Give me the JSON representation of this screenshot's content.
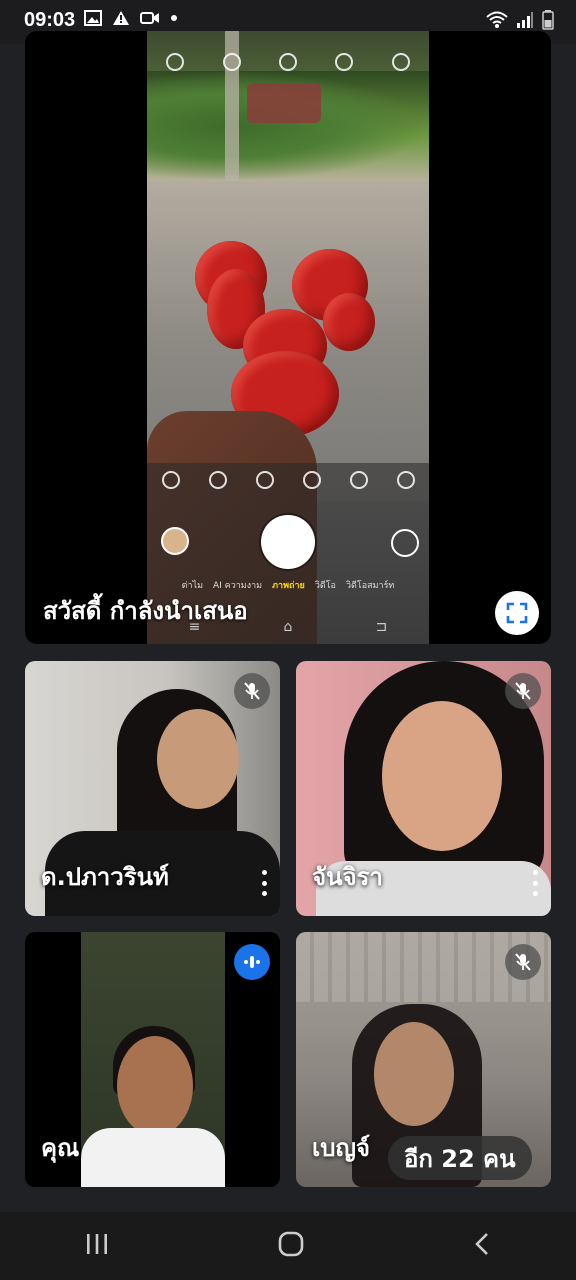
{
  "status_bar": {
    "time": "09:03",
    "left_icons": [
      "image-icon",
      "warning-icon",
      "video-icon",
      "dot-icon"
    ],
    "right_icons": [
      "wifi-icon",
      "signal-icon",
      "battery-icon"
    ]
  },
  "presentation": {
    "presenter_label": "สวัสดี้ กำลังนำเสนอ",
    "camera_modes": [
      "ต่าไม",
      "AI ความงาม",
      "ภาพถ่าย",
      "วิดีโอ",
      "วิดีโอสมาร์ท"
    ],
    "active_mode": "ภาพถ่าย",
    "fullscreen_icon": "fullscreen-icon"
  },
  "participants": [
    {
      "name": "ด.ปภาวรินท์",
      "muted": true
    },
    {
      "name": "จันจิรา",
      "muted": true
    },
    {
      "name": "คุณ",
      "speaking": true
    },
    {
      "name": "เบญจ์",
      "muted": true
    }
  ],
  "others_chip": "อีก 22 คน",
  "colors": {
    "accent": "#1a73e8",
    "background": "#202124",
    "tile_dark": "#000000"
  },
  "nav_bar": {
    "icons": [
      "recents-icon",
      "home-icon",
      "back-icon"
    ]
  }
}
